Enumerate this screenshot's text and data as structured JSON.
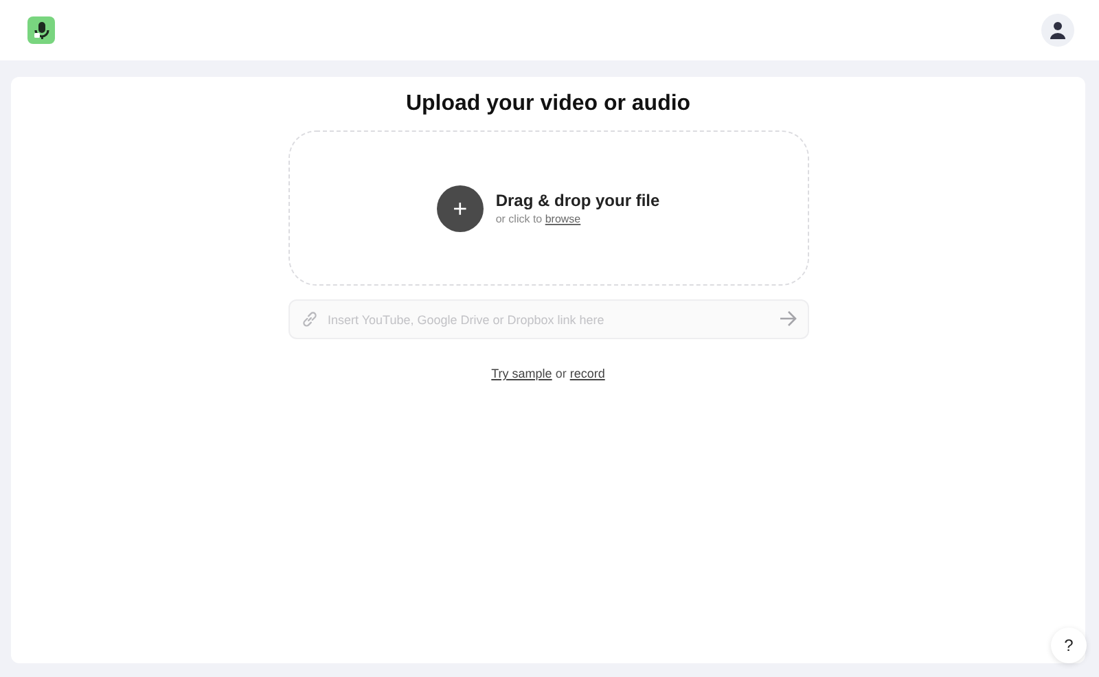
{
  "title": "Upload your video or audio",
  "dropzone": {
    "heading": "Drag & drop your file",
    "prefix": "or click to ",
    "link": "browse",
    "button": "+"
  },
  "link_field": {
    "placeholder": "Insert YouTube, Google Drive or Dropbox link here"
  },
  "alternatives": [
    {
      "kind": "link",
      "text": "Try sample"
    },
    {
      "kind": "text",
      "text": " or "
    },
    {
      "kind": "link",
      "text": "record"
    }
  ],
  "help": "?"
}
